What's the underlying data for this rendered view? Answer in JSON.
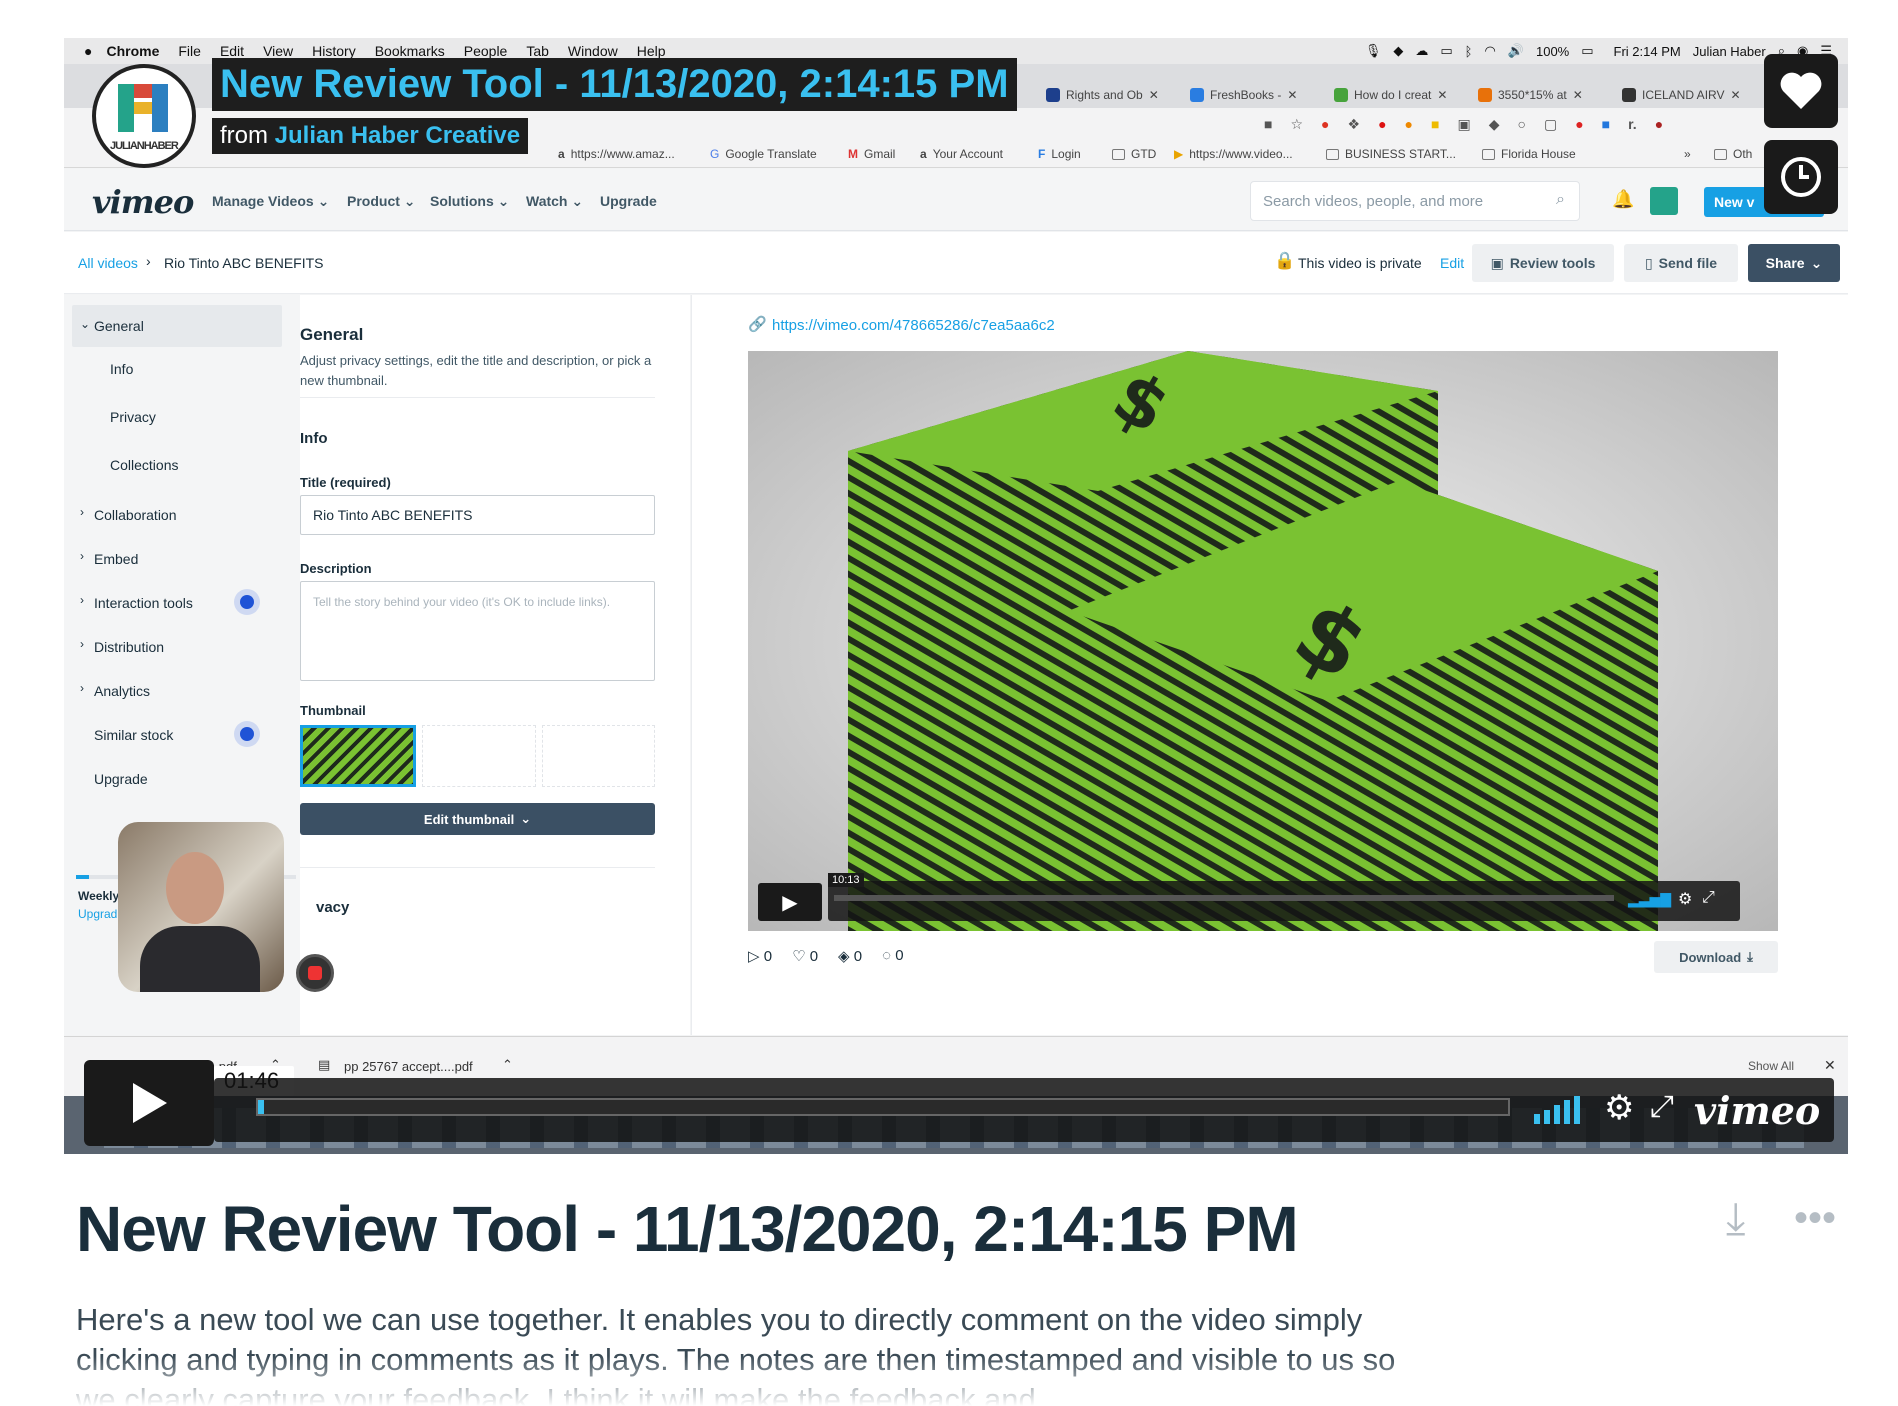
{
  "mac_menu": {
    "app": "Chrome",
    "items": [
      "File",
      "Edit",
      "View",
      "History",
      "Bookmarks",
      "People",
      "Tab",
      "Window",
      "Help"
    ],
    "battery": "100%",
    "clock": "Fri 2:14 PM",
    "user": "Julian Haber"
  },
  "tabs": [
    {
      "label": "Rights and Ob",
      "color": "#1d3f8c"
    },
    {
      "label": "FreshBooks -",
      "color": "#2a7de1"
    },
    {
      "label": "How do I creat",
      "color": "#47a33c"
    },
    {
      "label": "3550*15% at",
      "color": "#e8710a"
    },
    {
      "label": "ICELAND AIRV",
      "color": "#333333"
    }
  ],
  "bookmarks": [
    {
      "label": "https://www.amaz..."
    },
    {
      "label": "Google Translate"
    },
    {
      "label": "Gmail"
    },
    {
      "label": "Your Account"
    },
    {
      "label": "Login"
    },
    {
      "label": "GTD"
    },
    {
      "label": "https://www.video..."
    },
    {
      "label": "BUSINESS START..."
    },
    {
      "label": "Florida House"
    }
  ],
  "bookmarks_more": "»",
  "bookmarks_other": "Oth",
  "vimeo": {
    "logo": "vimeo",
    "nav": [
      "Manage Videos",
      "Product",
      "Solutions",
      "Watch",
      "Upgrade"
    ],
    "search_placeholder": "Search videos, people, and more",
    "new_label": "New v"
  },
  "breadcrumb": {
    "root": "All videos",
    "current": "Rio Tinto ABC BENEFITS"
  },
  "privacy": {
    "text": "This video is private",
    "edit": "Edit"
  },
  "actions": {
    "review": "Review tools",
    "send": "Send file",
    "share": "Share"
  },
  "sidebar": {
    "general": "General",
    "sub": [
      "Info",
      "Privacy",
      "Collections"
    ],
    "sections": [
      "Collaboration",
      "Embed",
      "Interaction tools",
      "Distribution",
      "Analytics",
      "Similar stock",
      "Upgrade"
    ],
    "weekly": "Weekly",
    "upgrade_link": "Upgrad"
  },
  "form": {
    "heading": "General",
    "intro": "Adjust privacy settings, edit the title and description, or pick a new thumbnail.",
    "info": "Info",
    "title_label": "Title (required)",
    "title_value": "Rio Tinto ABC BENEFITS",
    "desc_label": "Description",
    "desc_placeholder": "Tell the story behind your video (it's OK to include links).",
    "thumb_label": "Thumbnail",
    "edit_thumb": "Edit thumbnail",
    "privacy_cut": "vacy"
  },
  "player": {
    "url": "https://vimeo.com/478665286/c7ea5aa6c2",
    "timestamp": "10:13",
    "plays": "0",
    "likes": "0",
    "collections": "0",
    "comments": "0",
    "download": "Download"
  },
  "downloads": {
    "files": [
      "EOF+How+to+P....pdf",
      "pp 25767 accept....pdf"
    ],
    "show_all": "Show All"
  },
  "overlay": {
    "title": "New Review Tool - 11/13/2020, 2:14:15 PM",
    "from": "from",
    "author": "Julian Haber Creative",
    "time": "01:46",
    "vimeo": "vimeo",
    "logo_text": "JULIANHABER"
  },
  "page": {
    "title": "New Review Tool - 11/13/2020, 2:14:15 PM",
    "description": "Here's a new tool we can use together. It enables you to directly comment on the video simply clicking and typing in comments as it plays. The notes are then timestamped and visible to us so we clearly capture your feedback. I think it will make the feedback and"
  },
  "colors": {
    "accent": "#17a0e4",
    "overlay_blue": "#3ac0f0",
    "navy": "#1a2e3b",
    "green": "#7ac232"
  }
}
